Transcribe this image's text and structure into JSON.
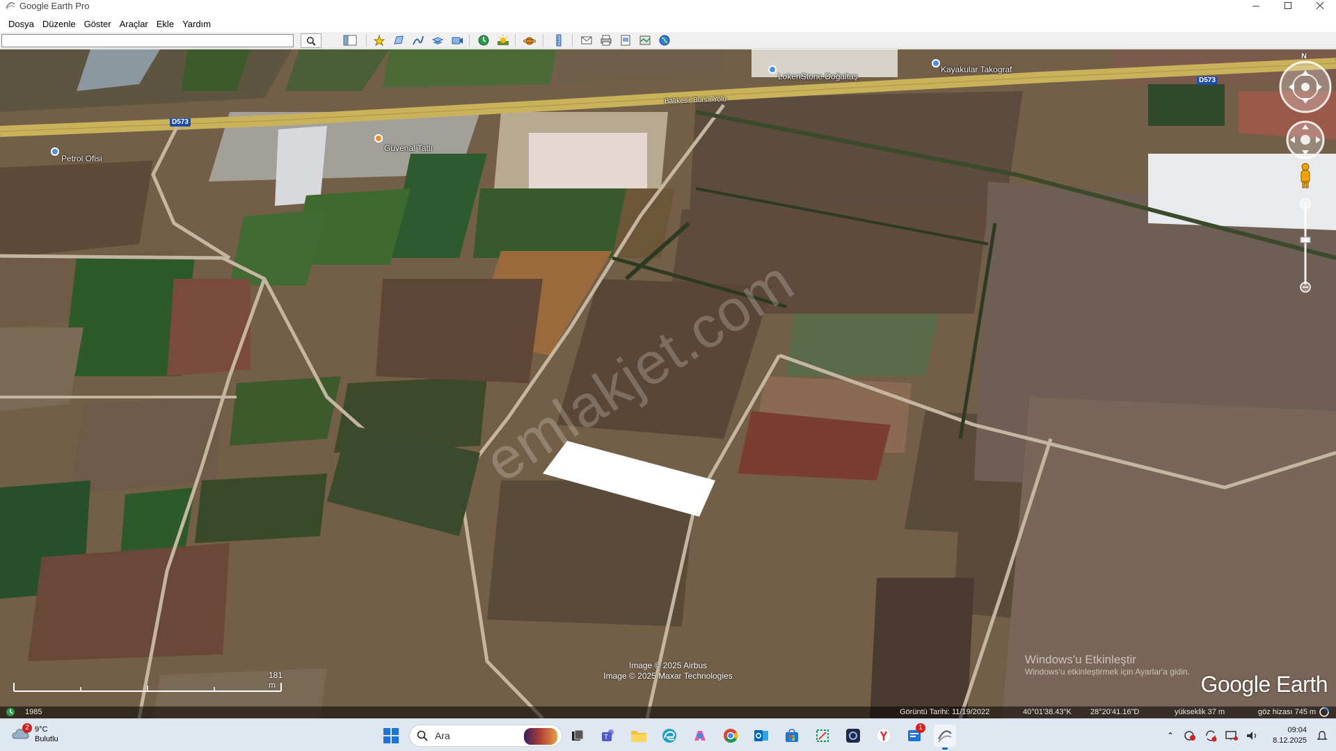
{
  "window": {
    "title": "Google Earth Pro"
  },
  "menu": [
    "Dosya",
    "Düzenle",
    "Göster",
    "Araçlar",
    "Ekle",
    "Yardım"
  ],
  "search": {
    "value": "",
    "placeholder": ""
  },
  "toolbar_icons": [
    "sidebar-icon",
    "placemark-icon",
    "polygon-icon",
    "path-icon",
    "image-overlay-icon",
    "record-tour-icon",
    "historical-imagery-icon",
    "sunlight-icon",
    "planets-icon",
    "ruler-icon",
    "email-icon",
    "print-icon",
    "save-image-icon",
    "view-in-maps-icon",
    "earth-icon"
  ],
  "map": {
    "labels": {
      "petrol": "Petrol Ofisi",
      "guvenal": "Güvenal Tatlı",
      "kayakular": "Kayakular Takograf",
      "lokenstone": "LokenStone Doğaltaş",
      "road_side": "Balıkesir Bursa Yolu"
    },
    "road_shields": [
      "D573",
      "D573"
    ],
    "watermark": "emlakjet.com",
    "compass_n": "N",
    "scale_label": "181 m",
    "credits": [
      "Image © 2025 Airbus",
      "Image © 2025 Maxar Technologies"
    ],
    "windows_activate": {
      "title": "Windows'u Etkinleştir",
      "subtitle": "Windows'u etkinleştirmek için Ayarlar'a gidin."
    },
    "logo": "Google Earth"
  },
  "status": {
    "year": "1985",
    "imagery_date": "Görüntü Tarihi: 11/19/2022",
    "lat": "40°01'38.43\"K",
    "lon": "28°20'41.16\"D",
    "elevation": "yükseklik   37 m",
    "eye_alt": "göz hizası   745 m"
  },
  "taskbar": {
    "weather": {
      "temp": "9°C",
      "cond": "Bulutlu",
      "badge": "2"
    },
    "search_label": "Ara",
    "apps": [
      "start-icon",
      "search-icon",
      "game-icon",
      "task-view-icon",
      "teams-icon",
      "file-explorer-icon",
      "edge-icon",
      "copilot-icon",
      "chrome-icon",
      "outlook-icon",
      "store-icon",
      "snipping-icon",
      "media-icon",
      "yandex-icon",
      "notification-app-icon",
      "google-earth-icon"
    ],
    "clock": {
      "time": "09:04",
      "date": "8.12.2025"
    },
    "app_badge": "1"
  },
  "colors": {
    "road": "#c9b25a",
    "shield": "#1d4fa8",
    "taskbar": "#dfe8f1",
    "accent": "#0067c0"
  }
}
